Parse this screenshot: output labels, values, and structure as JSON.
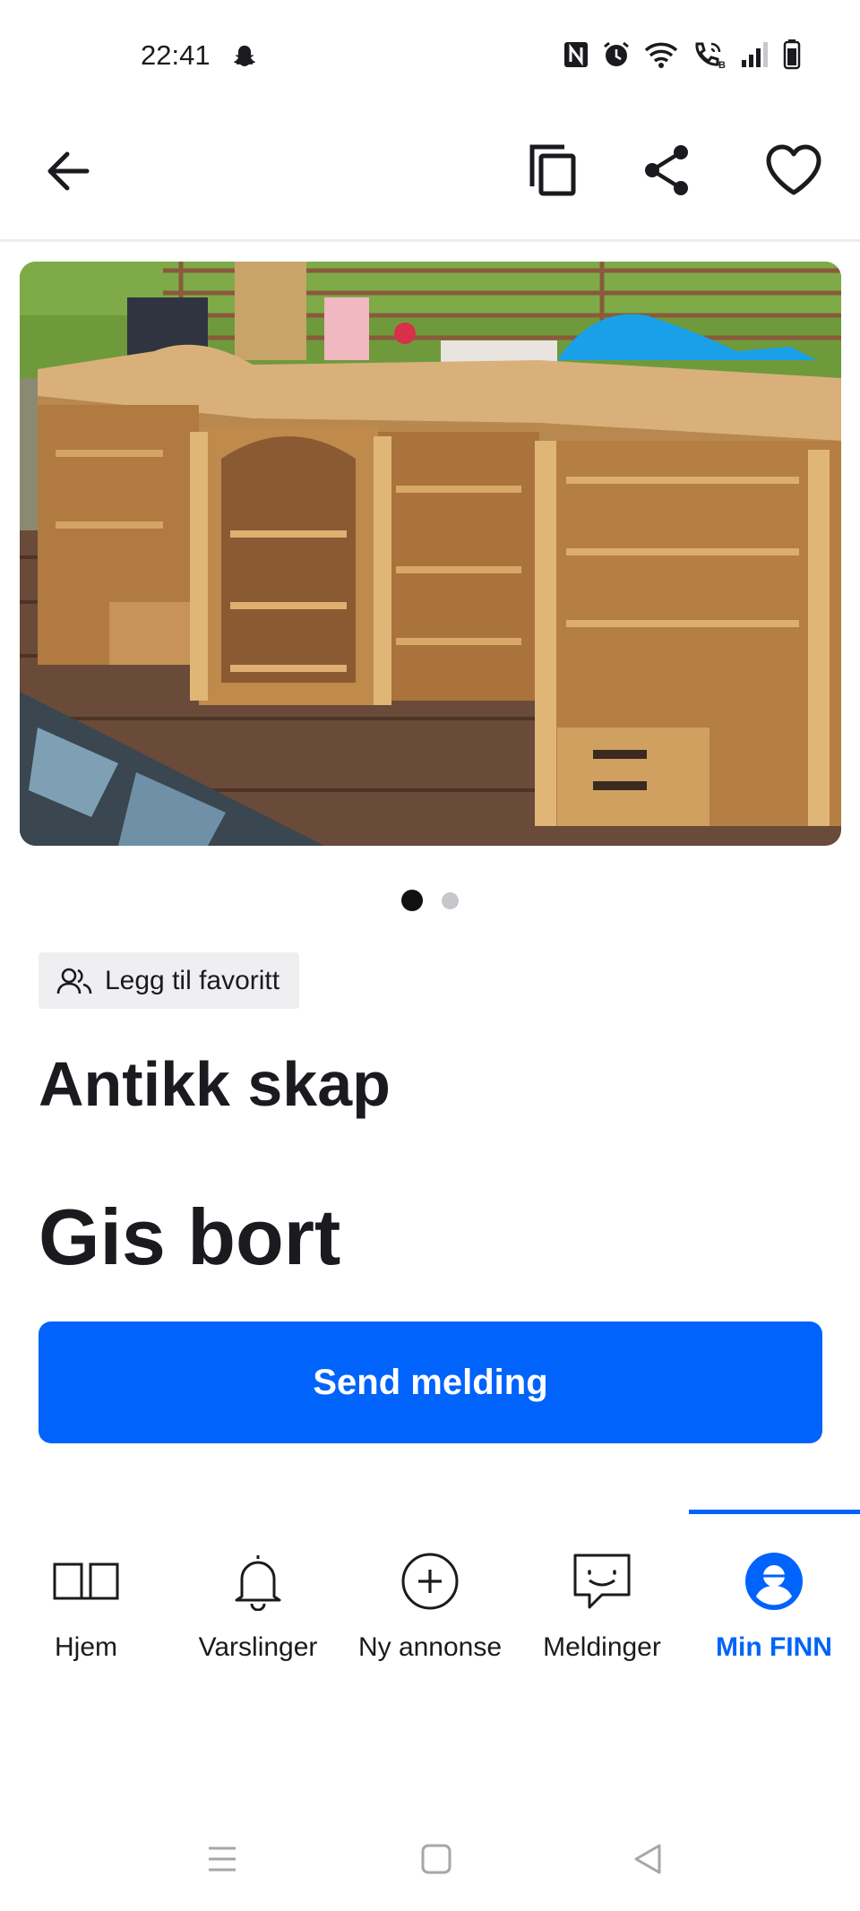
{
  "status_bar": {
    "time": "22:41",
    "icons": [
      "snapchat-icon",
      "nfc-icon",
      "alarm-icon",
      "wifi-icon",
      "wifi-call-icon",
      "signal-icon",
      "battery-icon"
    ],
    "call_badge": "B"
  },
  "toolbar": {
    "back_icon": "arrow-left-icon",
    "copy_icon": "copy-icon",
    "share_icon": "share-icon",
    "favorite_icon": "heart-outline-icon"
  },
  "gallery": {
    "image_alt": "Antikk skap",
    "page_count": 2,
    "current_page": 1
  },
  "listing": {
    "favorite_chip_label": "Legg til favoritt",
    "title": "Antikk skap",
    "price": "Gis bort",
    "send_button_label": "Send melding"
  },
  "bottom_nav": {
    "items": [
      {
        "label": "Hjem",
        "icon": "book-icon",
        "active": false
      },
      {
        "label": "Varslinger",
        "icon": "bell-icon",
        "active": false
      },
      {
        "label": "Ny annonse",
        "icon": "plus-circle-icon",
        "active": false
      },
      {
        "label": "Meldinger",
        "icon": "chat-bubble-icon",
        "active": false
      },
      {
        "label": "Min FINN",
        "icon": "profile-icon",
        "active": true
      }
    ]
  },
  "colors": {
    "accent": "#0063fb",
    "text": "#1b1b1f",
    "chip_background": "#efeff2"
  }
}
